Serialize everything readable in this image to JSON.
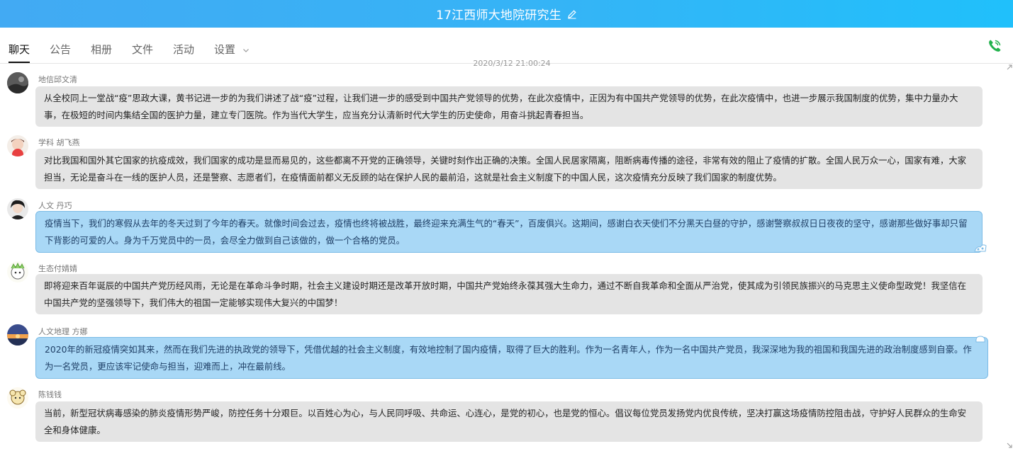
{
  "header": {
    "title": "17江西师大地院研究生"
  },
  "tabs": [
    {
      "label": "聊天",
      "active": true
    },
    {
      "label": "公告"
    },
    {
      "label": "相册"
    },
    {
      "label": "文件"
    },
    {
      "label": "活动"
    },
    {
      "label": "设置"
    }
  ],
  "timestamp": "2020/3/12 21:00:24",
  "messages": [
    {
      "sender": "地信邱文清",
      "text": "从全校同上一堂战“疫”思政大课，黄书记进一步的为我们讲述了战“疫”过程，让我们进一步的感受到中国共产党领导的优势，在此次疫情中，正因为有中国共产党领导的优势，在此次疫情中，也进一步展示我国制度的优势，集中力量办大事，在极短的时间内集结全国的医护力量，建立专门医院。作为当代大学生，应当充分认清新时代大学生的历史使命，用奋斗挑起青春担当。"
    },
    {
      "sender": "学科 胡飞燕",
      "text": "对比我国和国外其它国家的抗疫成效，我们国家的成功是显而易见的，这些都离不开党的正确领导，关键时刻作出正确的决策。全国人民居家隔离，阻断病毒传播的途径，非常有效的阻止了疫情的扩散。全国人民万众一心，国家有难，大家担当，无论是奋斗在一线的医护人员，还是警察、志愿者们，在疫情面前都义无反顾的站在保护人民的最前沿，这就是社会主义制度下的中国人民，这次疫情充分反映了我们国家的制度优势。"
    },
    {
      "sender": "人文  丹巧",
      "text": "疫情当下，我们的寒假从去年的冬天过到了今年的春天。就像时间会过去，疫情也终将被战胜，最终迎来充满生气的“春天”，百废俱兴。这期间，感谢白衣天使们不分黑天白昼的守护，感谢警察叔叔日日夜夜的坚守，感谢那些做好事却只留下背影的可爱的人。身为千万党员中的一员，会尽全力做到自己该做的，做一个合格的党员。"
    },
    {
      "sender": "生态付婧婧",
      "text": "即将迎来百年诞辰的中国共产党历经风雨，无论是在革命斗争时期，社会主义建设时期还是改革开放时期，中国共产党始终永葆其强大生命力，通过不断自我革命和全面从严治党，使其成为引领民族振兴的马克思主义使命型政党！我坚信在中国共产党的坚强领导下，我们伟大的祖国一定能够实现伟大复兴的中国梦！"
    },
    {
      "sender": "人文地理 方娜",
      "text": "2020年的新冠疫情突如其来，然而在我们先进的执政党的领导下，凭借优越的社会主义制度，有效地控制了国内疫情，取得了巨大的胜利。作为一名青年人，作为一名中国共产党员，我深深地为我的祖国和我国先进的政治制度感到自豪。作为一名党员，更应该牢记使命与担当，迎难而上，冲在最前线。"
    },
    {
      "sender": "陈钱钱",
      "text": "当前，新型冠状病毒感染的肺炎疫情形势严峻，防控任务十分艰巨。以百姓心为心，与人民同呼吸、共命运、心连心，是党的初心，也是党的恒心。倡议每位党员发扬党内优良传统，坚决打赢这场疫情防控阻击战，守护好人民群众的生命安全和身体健康。"
    }
  ],
  "colors": {
    "header_start": "#42aaf3",
    "header_end": "#20c0fb",
    "bubble_gray": "#e4e4e4",
    "bubble_blue": "#a9d8f6"
  },
  "icons": {
    "edit": "pencil-icon",
    "phone": "phone-icon",
    "settings_dropdown": "chevron-down-icon"
  }
}
